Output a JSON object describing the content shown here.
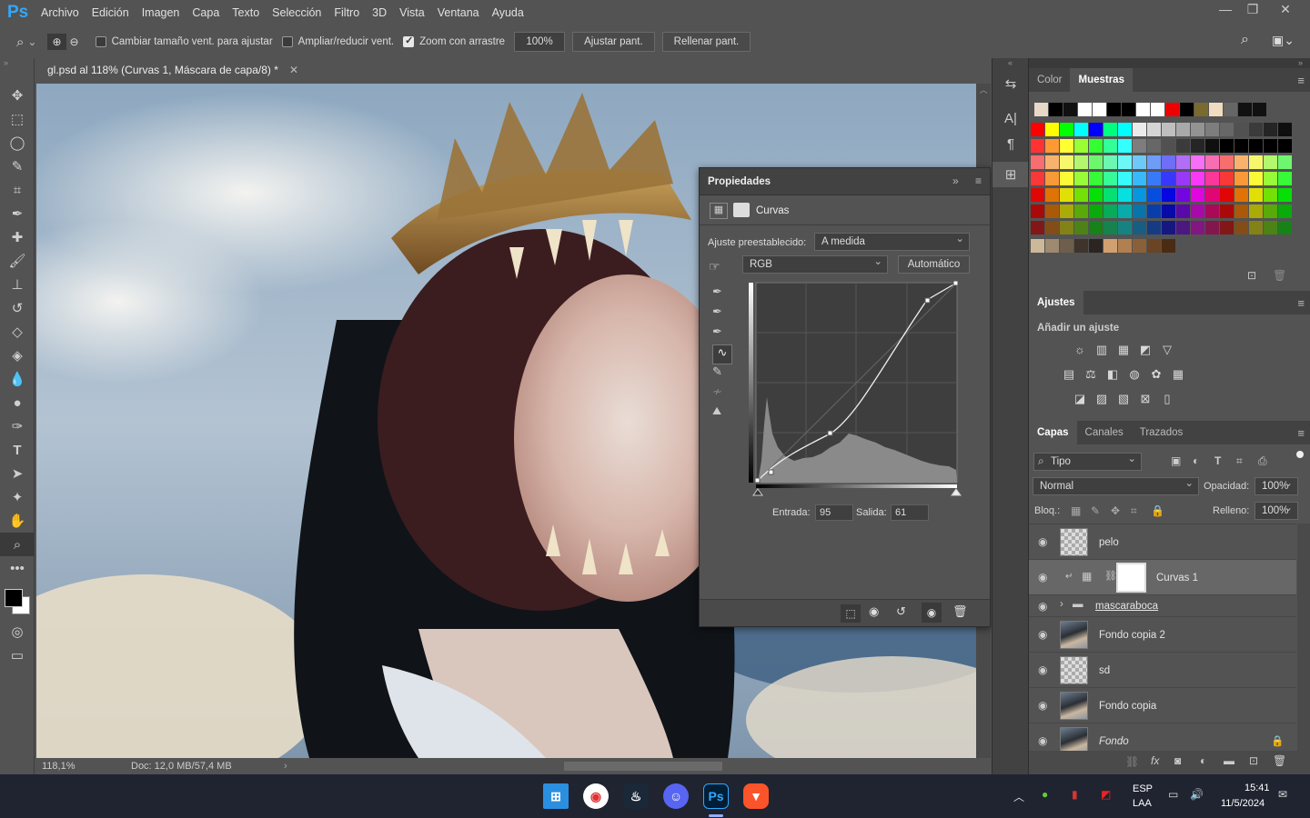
{
  "app": {
    "logo": "Ps"
  },
  "menu": [
    "Archivo",
    "Edición",
    "Imagen",
    "Capa",
    "Texto",
    "Selección",
    "Filtro",
    "3D",
    "Vista",
    "Ventana",
    "Ayuda"
  ],
  "options": {
    "resize_windows": "Cambiar tamaño vent. para ajustar",
    "zoom_all": "Ampliar/reducir vent.",
    "scrubby_zoom": "Zoom con arrastre",
    "zoom_value": "100%",
    "fit_screen": "Ajustar pant.",
    "fill_screen": "Rellenar pant."
  },
  "document": {
    "tab_title": "gl.psd al 118% (Curvas 1, Máscara de capa/8) *",
    "zoom": "118,1%",
    "doc_info": "Doc: 12,0 MB/57,4 MB"
  },
  "properties": {
    "title": "Propiedades",
    "adjustment": "Curvas",
    "preset_label": "Ajuste preestablecido:",
    "preset_value": "A medida",
    "channel": "RGB",
    "auto_button": "Automático",
    "input_label": "Entrada:",
    "input_value": "95",
    "output_label": "Salida:",
    "output_value": "61"
  },
  "swatches": {
    "tabs": [
      "Color",
      "Muestras"
    ],
    "active": "Muestras"
  },
  "adjustments": {
    "title": "Ajustes",
    "subtitle": "Añadir un ajuste"
  },
  "layers_panel": {
    "tabs": [
      "Capas",
      "Canales",
      "Trazados"
    ],
    "filter": "Tipo",
    "blend_mode": "Normal",
    "opacity_label": "Opacidad:",
    "opacity_value": "100%",
    "lock_label": "Bloq.:",
    "fill_label": "Relleno:",
    "fill_value": "100%",
    "layers": [
      {
        "name": "pelo",
        "thumb": "checker"
      },
      {
        "name": "Curvas 1",
        "thumb": "mask"
      },
      {
        "name": "mascaraboca",
        "thumb": "folder"
      },
      {
        "name": "Fondo copia 2",
        "thumb": "photo"
      },
      {
        "name": "sd",
        "thumb": "checker"
      },
      {
        "name": "Fondo copia",
        "thumb": "photo"
      },
      {
        "name": "Fondo",
        "thumb": "photo"
      }
    ]
  },
  "taskbar": {
    "language": "ESP",
    "layout": "LAA",
    "time": "15:41",
    "date": "11/5/2024"
  },
  "colors": {
    "ps_blue": "#31a8ff",
    "panel_bg": "#535353",
    "dark_bg": "#424242"
  }
}
